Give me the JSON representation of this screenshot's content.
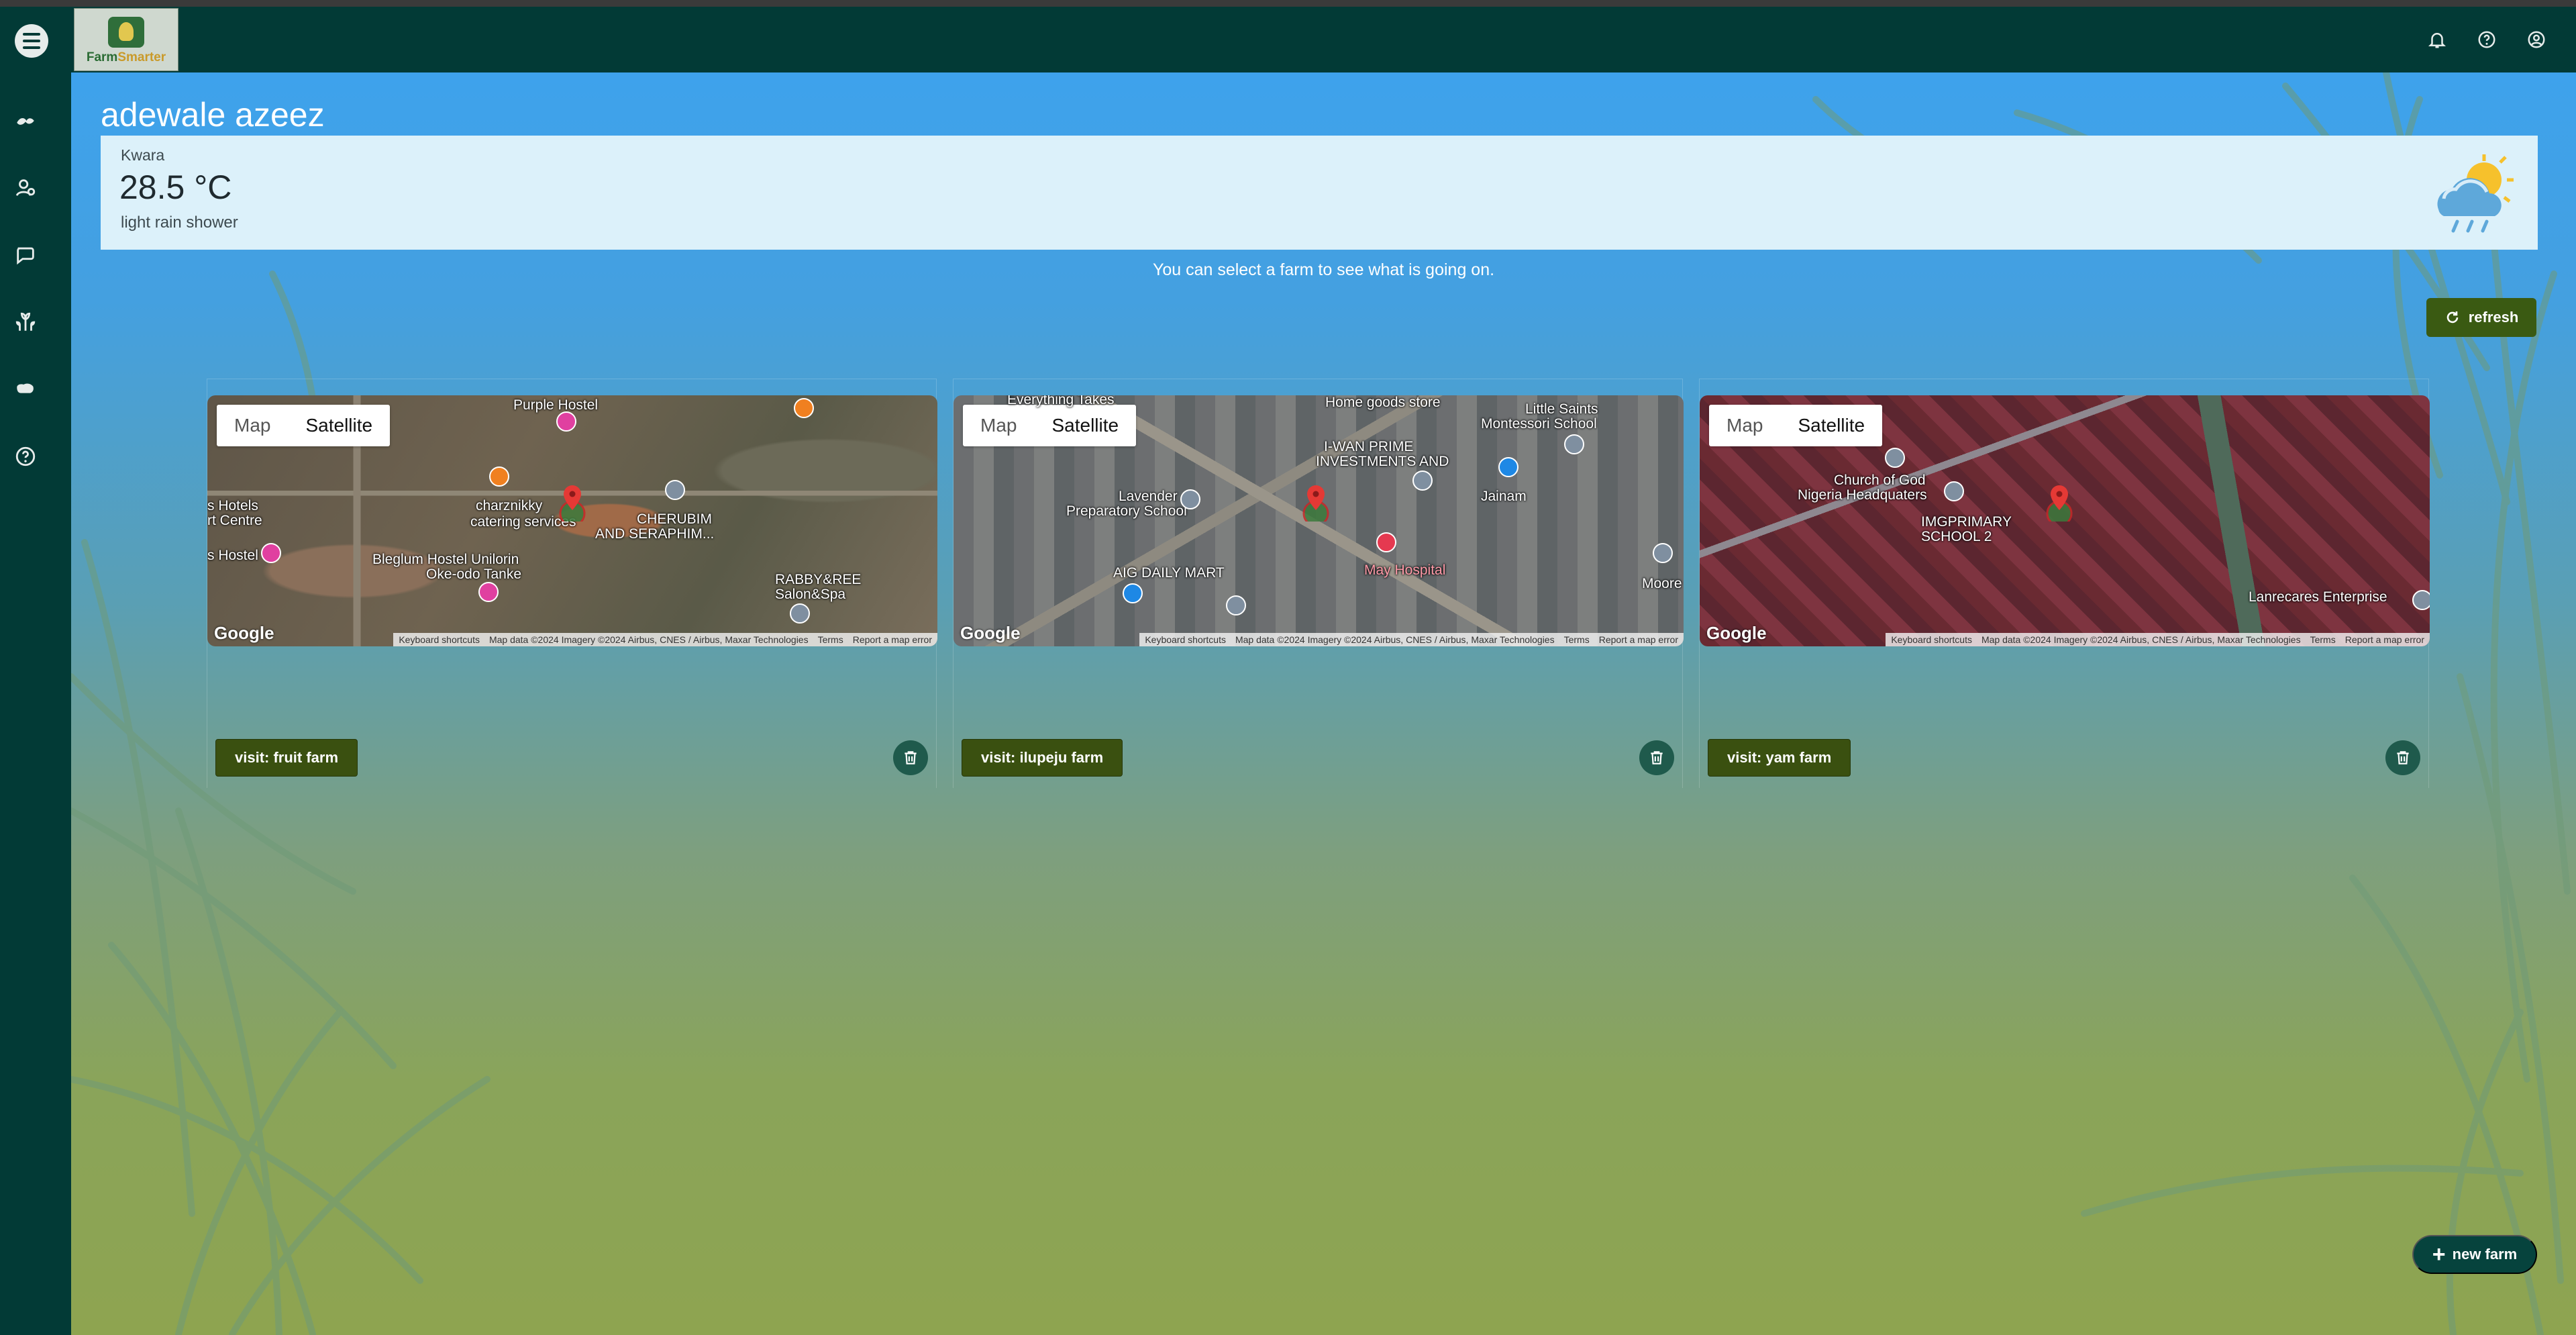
{
  "app": {
    "logo_text_a": "Farm",
    "logo_text_b": "Smarter"
  },
  "user": {
    "name": "adewale azeez"
  },
  "weather": {
    "location": "Kwara",
    "temperature": "28.5 °C",
    "description": "light rain shower",
    "icon": "cloud-sun-rain-icon"
  },
  "hint": "You can select a farm to see what is going on.",
  "refresh_label": "refresh",
  "new_farm_label": "new farm",
  "map_common": {
    "map_label": "Map",
    "satellite_label": "Satellite",
    "google": "Google",
    "keyboard": "Keyboard shortcuts",
    "map_data": "Map data ©2024 Imagery ©2024 Airbus, CNES / Airbus, Maxar Technologies",
    "terms": "Terms",
    "report": "Report a map error"
  },
  "farms": [
    {
      "visit_label": "visit: fruit farm",
      "labels": [
        "Purple Hostel",
        "charznikky",
        "catering services",
        "CHERUBIM",
        "AND SERAPHIM...",
        "Bleglum Hostel Unilorin",
        "Oke-odo Tanke",
        "RABBY&REE",
        "Salon&Spa",
        "s Hotels",
        "rt Centre",
        "s Hostel"
      ]
    },
    {
      "visit_label": "visit: ilupeju farm",
      "labels": [
        "Everything Takes",
        "Home goods store",
        "Little Saints",
        "Montessori School",
        "I-WAN PRIME",
        "INVESTMENTS AND",
        "Lavender",
        "Preparatory School",
        "Jainam",
        "May Hospital",
        "AIG DAILY MART",
        "Moore"
      ]
    },
    {
      "visit_label": "visit: yam farm",
      "labels": [
        "Church of God",
        "Nigeria Headquaters",
        "IMGPRIMARY",
        "SCHOOL 2",
        "Lanrecares Enterprise"
      ]
    }
  ],
  "colors": {
    "sidebar": "#023a36",
    "button": "#3a5010",
    "weather_card": "#dcf1fa",
    "pin": "#e53935"
  }
}
